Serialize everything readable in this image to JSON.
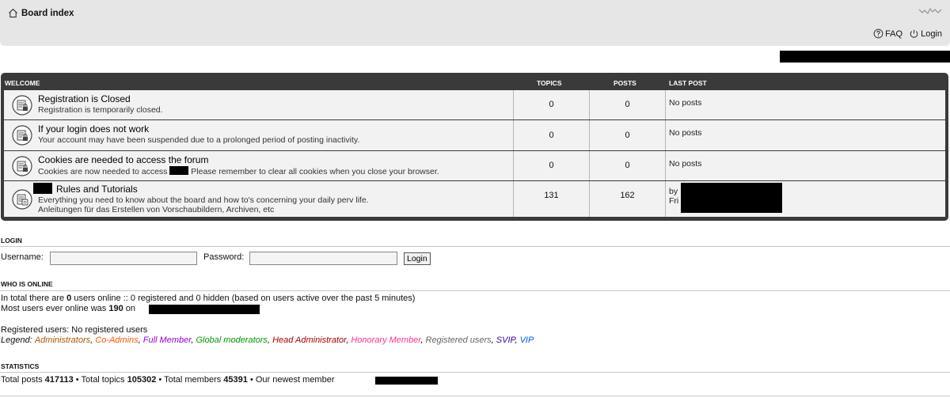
{
  "header": {
    "breadcrumb": "Board index",
    "faq_label": "FAQ",
    "login_label": "Login"
  },
  "forum_table": {
    "columns": {
      "welcome": "WELCOME",
      "topics": "TOPICS",
      "posts": "POSTS",
      "last_post": "LAST POST"
    },
    "rows": [
      {
        "title": "Registration is Closed",
        "desc": "Registration is temporarily closed.",
        "topics": "0",
        "posts": "0",
        "last_post": "No posts"
      },
      {
        "title": "If your login does not work",
        "desc": "Your account may have been suspended due to a prolonged period of posting inactivity.",
        "topics": "0",
        "posts": "0",
        "last_post": "No posts"
      },
      {
        "title": "Cookies are needed to access the forum",
        "desc_a": "Cookies are now needed to access",
        "desc_b": "Please remember to clear all cookies when you close your browser.",
        "topics": "0",
        "posts": "0",
        "last_post": "No posts"
      },
      {
        "title": "Rules and Tutorials",
        "desc": "Everything you need to know about the board and how to's concerning your daily perv life.",
        "desc2": "Anleitungen für das Erstellen von Vorschaubildern, Archiven, etc",
        "topics": "131",
        "posts": "162",
        "last_by": "by",
        "last_day": "Fri"
      }
    ]
  },
  "login": {
    "heading": "LOGIN",
    "username_label": "Username:",
    "password_label": "Password:",
    "button_label": "Login"
  },
  "online": {
    "heading": "WHO IS ONLINE",
    "line1_a": "In total there are ",
    "line1_count": "0",
    "line1_b": " users online :: 0 registered and 0 hidden (based on users active over the past 5 minutes)",
    "line2_a": "Most users ever online was ",
    "line2_count": "190",
    "line2_b": " on",
    "registered": "Registered users: No registered users",
    "legend_label": "Legend:",
    "legend": [
      {
        "name": "Administrators",
        "color": "#aa5500"
      },
      {
        "name": "Co-Admins",
        "color": "#ff5500"
      },
      {
        "name": "Full Member",
        "color": "#9900cc"
      },
      {
        "name": "Global moderators",
        "color": "#009900"
      },
      {
        "name": "Head Administrator",
        "color": "#aa0000"
      },
      {
        "name": "Honorary Member",
        "color": "#ff3399"
      },
      {
        "name": "Registered users",
        "color": "#666666"
      },
      {
        "name": "SVIP",
        "color": "#330099"
      },
      {
        "name": "VIP",
        "color": "#0055ff"
      }
    ]
  },
  "statistics": {
    "heading": "STATISTICS",
    "posts_label": "Total posts ",
    "posts": "417113",
    "topics_label": " • Total topics ",
    "topics": "105302",
    "members_label": " • Total members ",
    "members": "45391",
    "newest_label": " • Our newest member"
  }
}
